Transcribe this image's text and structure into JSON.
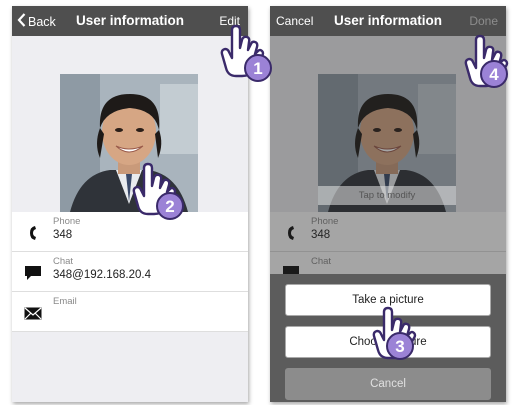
{
  "left_screen": {
    "nav": {
      "back_label": "Back",
      "title": "User information",
      "edit_label": "Edit"
    },
    "contact": [
      {
        "label": "Phone",
        "value": "348",
        "icon": "phone-icon"
      },
      {
        "label": "Chat",
        "value": "348@192.168.20.4",
        "icon": "chat-icon"
      },
      {
        "label": "Email",
        "value": "",
        "icon": "envelope-icon"
      }
    ]
  },
  "right_screen": {
    "nav": {
      "cancel_label": "Cancel",
      "title": "User information",
      "done_label": "Done"
    },
    "photo_hint": "Tap to modify",
    "contact": [
      {
        "label": "Phone",
        "value": "348",
        "icon": "phone-icon"
      },
      {
        "label": "Chat"
      }
    ],
    "action_sheet": {
      "take_picture": "Take a picture",
      "choose_picture": "Choose picture",
      "cancel": "Cancel"
    }
  },
  "steps": [
    "1",
    "2",
    "3",
    "4"
  ],
  "colors": {
    "navbar": "#4f4f4f",
    "badge": "#9b82d6",
    "sheet": "#5c5c5c"
  }
}
